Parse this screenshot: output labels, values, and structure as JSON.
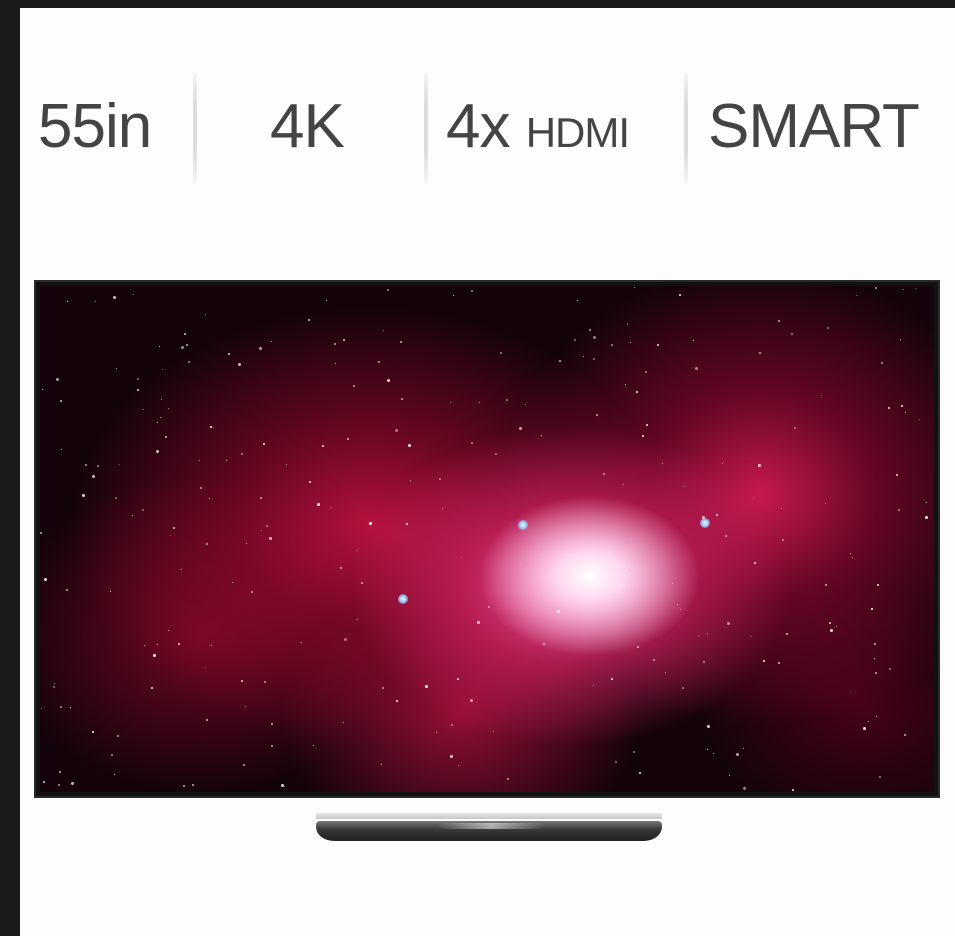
{
  "specs": [
    {
      "value": "55in"
    },
    {
      "value": "4K"
    },
    {
      "number": "4x",
      "unit": "HDMI"
    },
    {
      "value": "SMART"
    }
  ],
  "product": {
    "type": "television",
    "screen_content": "red nebula starfield",
    "colors": {
      "nebula": "#d81e5b",
      "core": "#ffd6f0",
      "space": "#14030a",
      "bezel": "#111111",
      "stand": "#2a2a2a"
    }
  }
}
